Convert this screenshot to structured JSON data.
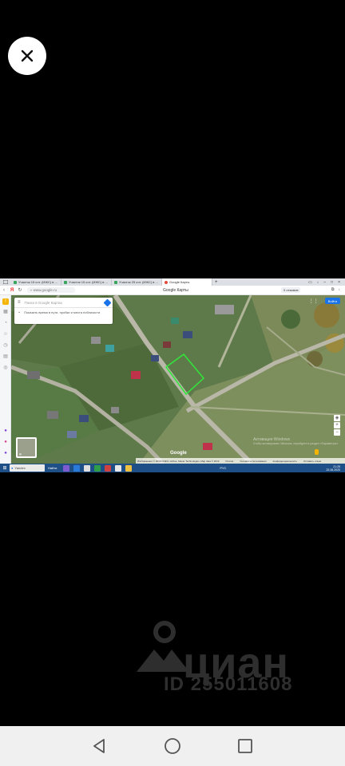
{
  "browser": {
    "tabs": [
      {
        "label": "Участок 15 сот. (ИЖС) в ..."
      },
      {
        "label": "Участок 15 сот. (ИЖС) в ..."
      },
      {
        "label": "Участок 25 сот. (ИЖС) в ..."
      },
      {
        "label": "Google Карты"
      }
    ],
    "new_tab": "+",
    "url": "www.google.ru",
    "page_title": "Google Карты",
    "reviews_button": "0 отзывов"
  },
  "map": {
    "search_placeholder": "Поиск в Google Картах",
    "hint_text": "Показать время в пути, пробки и места поблизости",
    "login_button": "Войти",
    "google_logo": "Google",
    "attribution": [
      "Изображения © 2019 CNES / Airbus, Maxar Technologies, Map data © 2019",
      "Россия",
      "Условия использования",
      "Конфиденциальность",
      "Оставить отзыв"
    ],
    "zoom_in": "+",
    "zoom_out": "−",
    "activate_windows": {
      "title": "Активация Windows",
      "subtitle": "Чтобы активировать Windows, перейдите в раздел «Параметры»."
    }
  },
  "taskbar": {
    "search_label": "Yandex",
    "task_label": "Найти",
    "time": "21:25",
    "date": "22.06.2020",
    "lang": "РУС"
  },
  "watermark": {
    "brand": "циан",
    "listing_id": "ID 255011608"
  },
  "colors": {
    "accent": "#1a73e8",
    "taskbar": "#1e4f86",
    "parcel_outline": "#2fe83a"
  }
}
